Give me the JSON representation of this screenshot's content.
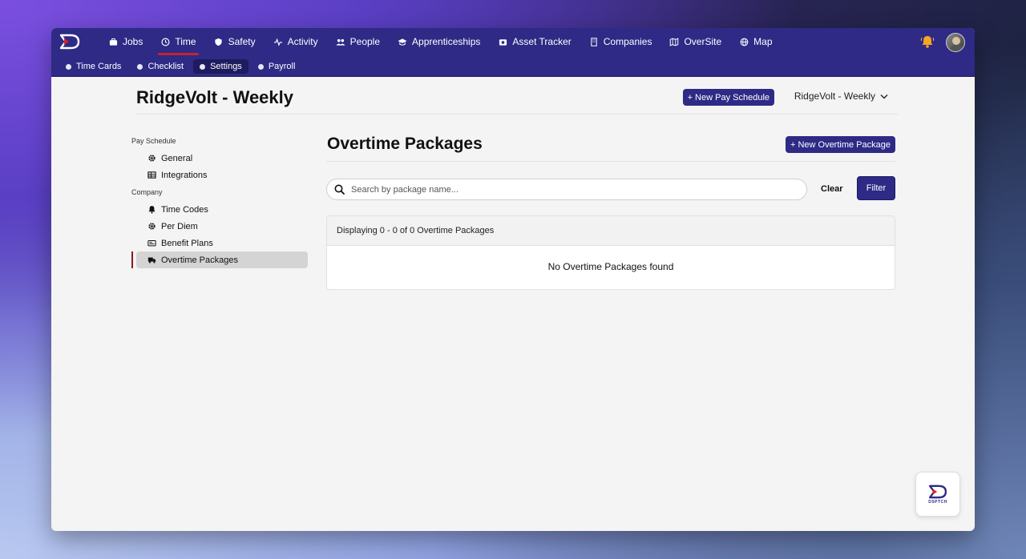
{
  "nav": {
    "items": [
      {
        "label": "Jobs",
        "icon": "briefcase-icon"
      },
      {
        "label": "Time",
        "icon": "clock-icon",
        "active": true
      },
      {
        "label": "Safety",
        "icon": "shield-icon"
      },
      {
        "label": "Activity",
        "icon": "activity-icon"
      },
      {
        "label": "People",
        "icon": "people-icon"
      },
      {
        "label": "Apprenticeships",
        "icon": "graduation-cap-icon"
      },
      {
        "label": "Asset Tracker",
        "icon": "camera-box-icon"
      },
      {
        "label": "Companies",
        "icon": "building-icon"
      },
      {
        "label": "OverSite",
        "icon": "map-book-icon"
      },
      {
        "label": "Map",
        "icon": "globe-icon"
      }
    ]
  },
  "subnav": {
    "items": [
      {
        "label": "Time Cards"
      },
      {
        "label": "Checklist"
      },
      {
        "label": "Settings",
        "active": true
      },
      {
        "label": "Payroll"
      }
    ]
  },
  "header": {
    "title": "RidgeVolt - Weekly",
    "new_pay_schedule": "+ New Pay Schedule",
    "schedule_select": "RidgeVolt - Weekly"
  },
  "sidebar": {
    "pay_schedule_heading": "Pay Schedule",
    "company_heading": "Company",
    "pay_items": [
      {
        "label": "General",
        "icon": "gear-icon"
      },
      {
        "label": "Integrations",
        "icon": "table-icon"
      }
    ],
    "company_items": [
      {
        "label": "Time Codes",
        "icon": "bell-icon"
      },
      {
        "label": "Per Diem",
        "icon": "gear-icon"
      },
      {
        "label": "Benefit Plans",
        "icon": "card-icon"
      },
      {
        "label": "Overtime Packages",
        "icon": "truck-icon",
        "active": true
      }
    ]
  },
  "main": {
    "title": "Overtime Packages",
    "new_button": "+ New Overtime Package",
    "search_placeholder": "Search by package name...",
    "clear": "Clear",
    "filter": "Filter",
    "displaying": "Displaying 0 - 0 of 0 Overtime Packages",
    "empty": "No Overtime Packages found"
  },
  "fab": {
    "label": "DSPTCH"
  },
  "colors": {
    "brand": "#2e2a86",
    "accent": "#c0262e",
    "bell": "#f5a623"
  }
}
